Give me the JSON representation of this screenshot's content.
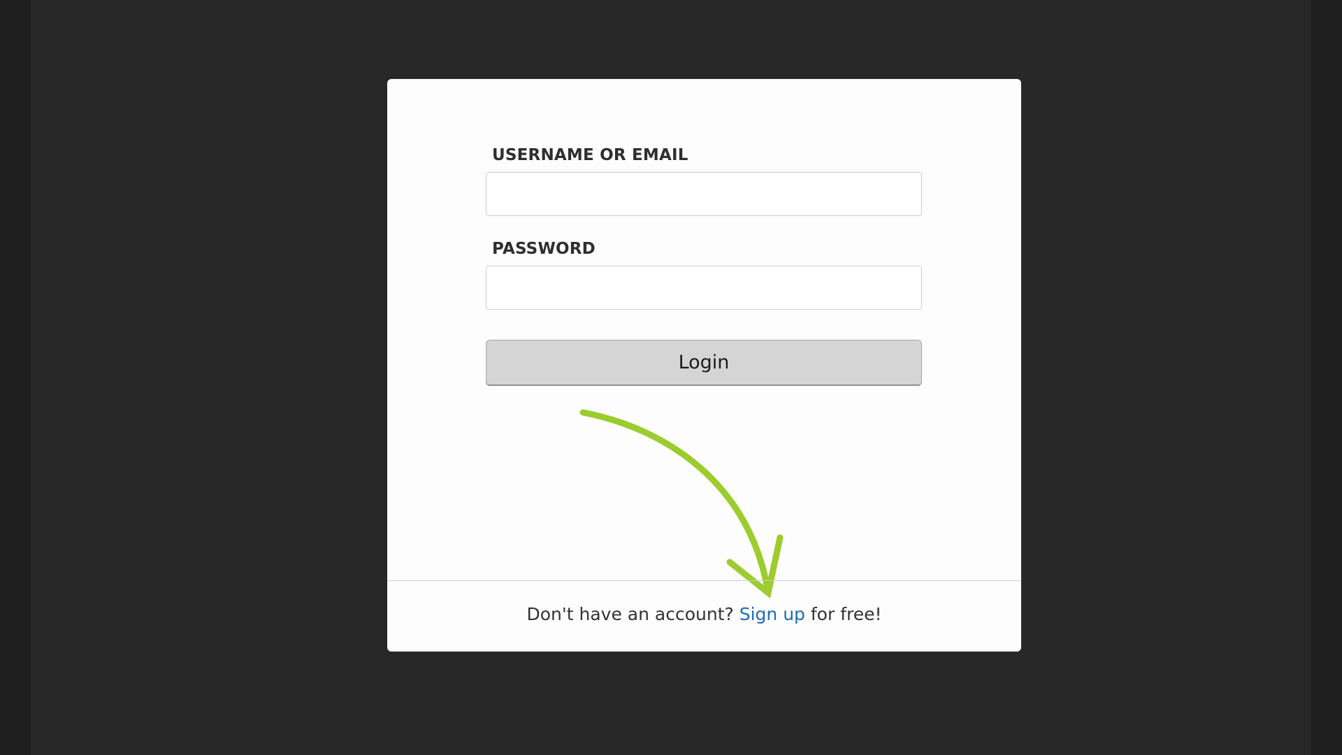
{
  "form": {
    "username_label": "USERNAME OR EMAIL",
    "username_value": "",
    "password_label": "PASSWORD",
    "password_value": "",
    "login_label": "Login"
  },
  "footer": {
    "prompt": "Don't have an account?",
    "signup_link": "Sign up",
    "suffix": "for free!"
  },
  "colors": {
    "arrow": "#9ccc2e",
    "link": "#1e6bb8",
    "button": "#d5d5d5"
  }
}
